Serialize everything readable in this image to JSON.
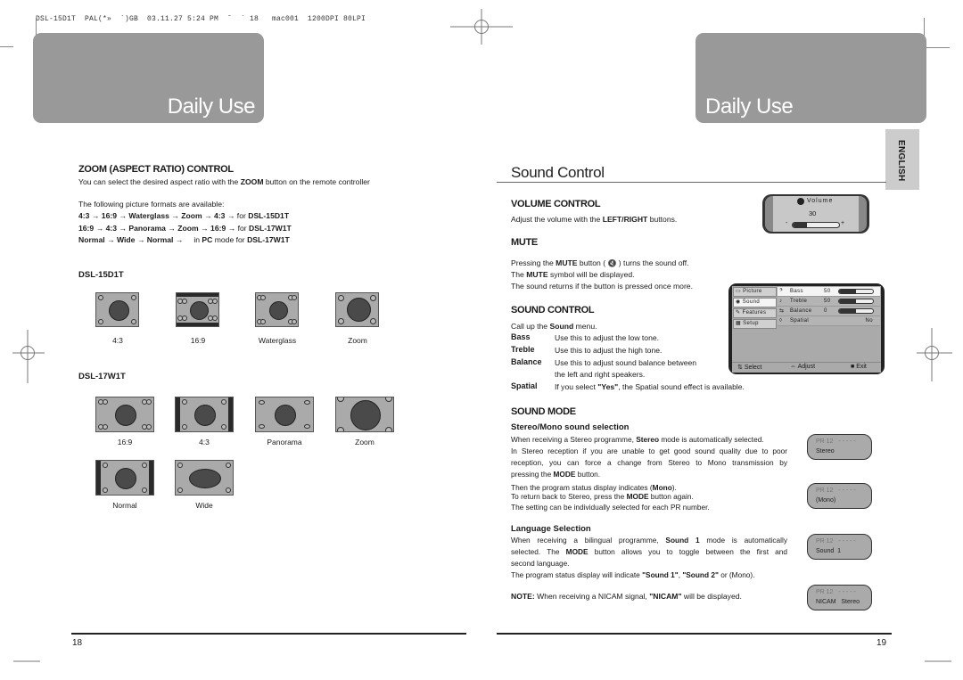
{
  "print_header": "DSL-15D1T  PAL(*»  ´)GB  03.11.27 5:24 PM  ˘  ` 18   mac001  1200DPI 80LPI",
  "left_page": {
    "banner_title": "Daily Use",
    "page_number": "18",
    "zoom_section": {
      "heading": "ZOOM (ASPECT RATIO) CONTROL",
      "intro_before": "You can select the desired aspect ratio with the ",
      "intro_bold": "ZOOM",
      "intro_after": " button on the remote controller",
      "formats_intro": "The following picture formats are available:",
      "format_sequences": [
        {
          "sequence": "4:3 → 16:9 → Waterglass → Zoom → 4:3 →",
          "suffix": " for ",
          "model": "DSL-15D1T"
        },
        {
          "sequence": "16:9 → 4:3 → Panorama → Zoom → 16:9 →",
          "suffix": "  for ",
          "model": "DSL-17W1T"
        },
        {
          "sequence": "Normal → Wide → Normal →",
          "suffix_pre": "     in ",
          "suffix_bold": "PC",
          "suffix": " mode for ",
          "model": "DSL-17W1T"
        }
      ]
    },
    "models": [
      {
        "name": "DSL-15D1T",
        "formats": [
          "4:3",
          "16:9",
          "Waterglass",
          "Zoom"
        ]
      },
      {
        "name": "DSL-17W1T",
        "formats": [
          "16:9",
          "4:3",
          "Panorama",
          "Zoom",
          "Normal",
          "Wide"
        ]
      }
    ]
  },
  "right_page": {
    "banner_title": "Daily Use",
    "page_number": "19",
    "language_tab": "ENGLISH",
    "section_title": "Sound Control",
    "volume": {
      "heading": "VOLUME CONTROL",
      "text_before": "Adjust the volume with the ",
      "text_bold": "LEFT/RIGHT",
      "text_after": " buttons.",
      "osd_label": "Volume",
      "osd_value": "30",
      "osd_fill_fraction": 0.3,
      "minus": "-",
      "plus": "+"
    },
    "mute": {
      "heading": "MUTE",
      "line1_before": "Pressing the ",
      "line1_bold": "MUTE",
      "line1_mid": " button ( ",
      "line1_icon": "🔇",
      "line1_after": " ) turns the sound off.",
      "line2_before": "The ",
      "line2_bold": "MUTE",
      "line2_after": " symbol will be displayed.",
      "line3": "The sound returns if the button is pressed once more."
    },
    "sound_control": {
      "heading": "SOUND CONTROL",
      "intro_before": "Call up the ",
      "intro_bold": "Sound",
      "intro_after": " menu.",
      "terms": [
        {
          "term": "Bass",
          "desc": "Use this to adjust the low tone."
        },
        {
          "term": "Treble",
          "desc": "Use this to adjust the high tone."
        },
        {
          "term": "Balance",
          "desc": "Use this to adjust sound balance between",
          "desc2": "the left and right speakers."
        },
        {
          "term": "Spatial",
          "desc_before": "If you select ",
          "desc_bold": "\"Yes\"",
          "desc_after": ", the Spatial sound effect is available."
        }
      ],
      "osd_menu": {
        "tabs": [
          "Picture",
          "Sound",
          "Features",
          "Setup"
        ],
        "active_tab": "Sound",
        "rows": [
          {
            "label": "Bass",
            "value": "50",
            "fill": 0.5
          },
          {
            "label": "Treble",
            "value": "50",
            "fill": 0.5
          },
          {
            "label": "Balance",
            "value": "0",
            "fill": 0.5
          },
          {
            "label": "Spatial",
            "value": "No"
          }
        ],
        "footer": {
          "select": "Select",
          "adjust": "Adjust",
          "exit": "Exit"
        }
      }
    },
    "sound_mode": {
      "heading": "SOUND MODE",
      "stereo_mono": {
        "subheading": "Stereo/Mono sound selection",
        "p1_before": "When receiving a Stereo programme, ",
        "p1_bold": "Stereo",
        "p1_after": " mode is automatically selected.",
        "p2_l1": "In Stereo reception if you are unable to get good sound quality due to poor",
        "p2_l2": "reception, you can force a change from Stereo to Mono transmission by",
        "p2_l3_before": "pressing the ",
        "p2_l3_bold": "MODE",
        "p2_l3_after": " button.",
        "p3_before": "Then the program status display indicates (",
        "p3_bold": "Mono",
        "p3_after": ").",
        "p4_before": "To return back to Stereo, press the ",
        "p4_bold": "MODE",
        "p4_after": " button again.",
        "p5": "The setting can be individually selected for each PR number."
      },
      "language": {
        "subheading": "Language Selection",
        "l1_before": "When receiving a bilingual programme, ",
        "l1_bold": "Sound 1",
        "l1_after": " mode is automatically",
        "l2_before": "selected. The ",
        "l2_bold": "MODE",
        "l2_after": " button allows you to toggle between the first and",
        "l3": "second language.",
        "l4_before": "The program status display will indicate ",
        "l4_bold1": "\"Sound 1\"",
        "l4_mid": ", ",
        "l4_bold2": "\"Sound 2\"",
        "l4_after": " or (Mono)."
      },
      "note": {
        "label": "NOTE:",
        "before": " When receiving a NICAM signal, ",
        "bold": "\"NICAM\"",
        "after": " will be displayed."
      },
      "status_displays": [
        {
          "pr": "PR 12   - - - - -",
          "status": "Stereo"
        },
        {
          "pr": "PR 12   - - - - -",
          "status": "(Mono)"
        },
        {
          "pr": "PR 12   - - - - -",
          "status": "Sound  1"
        },
        {
          "pr": "PR 12   - - - - -",
          "status": "NICAM   Stereo"
        }
      ]
    }
  }
}
